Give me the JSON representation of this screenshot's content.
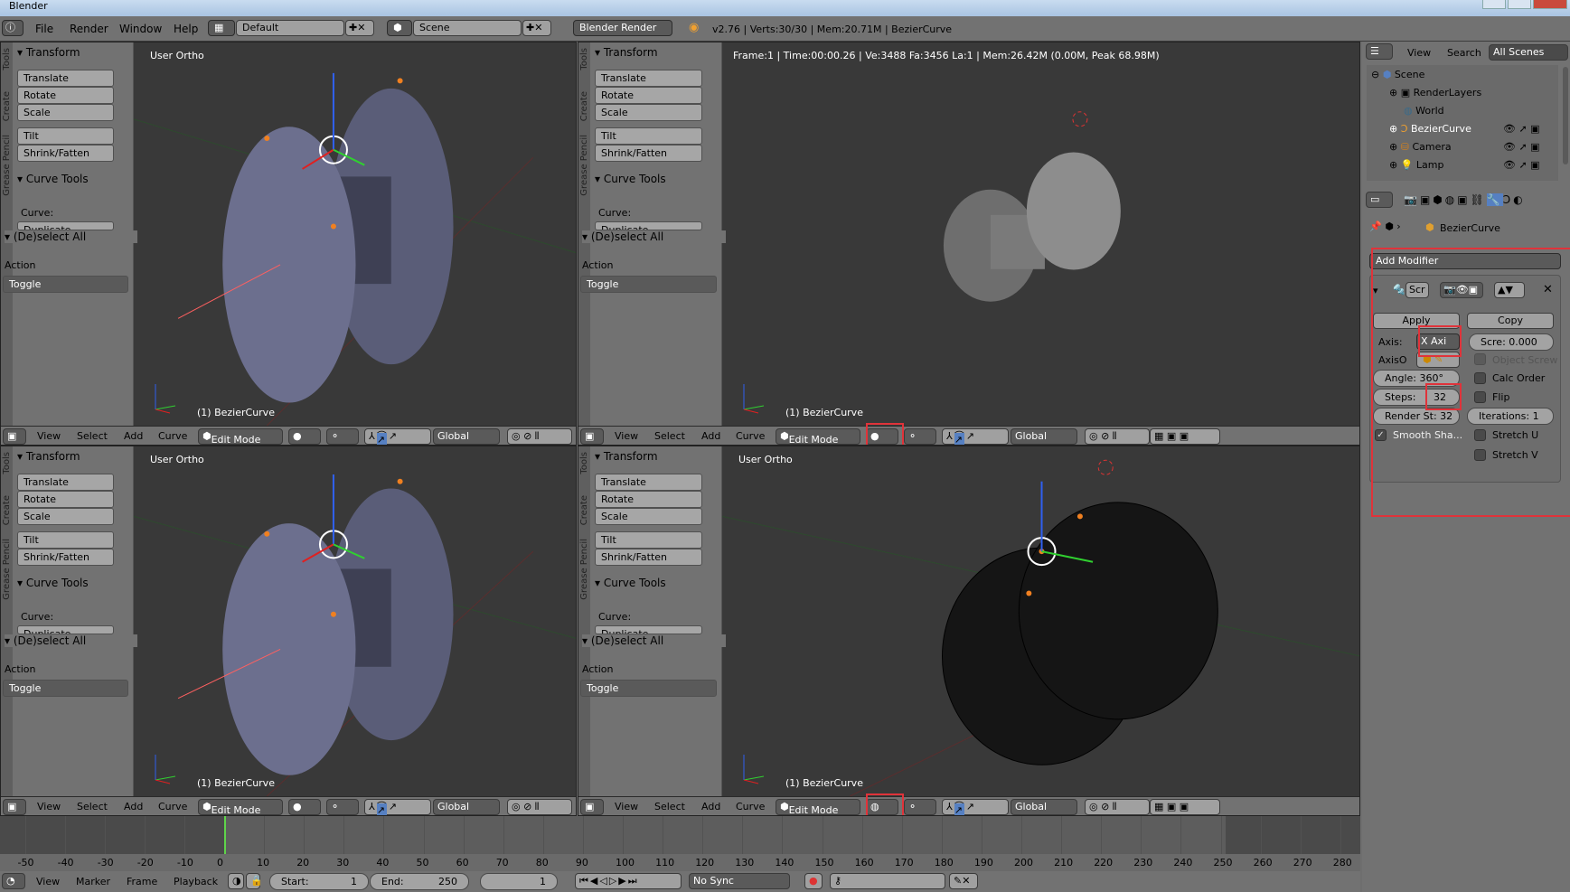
{
  "window": {
    "title": "Blender"
  },
  "topbar": {
    "menus": [
      "File",
      "Render",
      "Window",
      "Help"
    ],
    "layout": "Default",
    "scene": "Scene",
    "engine": "Blender Render",
    "stats": "v2.76 | Verts:30/30 | Mem:20.71M | BezierCurve"
  },
  "shelf": {
    "transform": "Transform",
    "buttons": [
      "Translate",
      "Rotate",
      "Scale",
      "Tilt",
      "Shrink/Fatten"
    ],
    "curve_tools": "Curve Tools",
    "curve_label": "Curve:",
    "duplicate": "Duplicate",
    "deselect": "(De)select All",
    "action": "Action",
    "toggle": "Toggle",
    "tabs": [
      "Tools",
      "Create",
      "Grease Pencil"
    ]
  },
  "views": [
    {
      "label": "User Ortho",
      "object": "(1) BezierCurve",
      "shading": "solid"
    },
    {
      "label": "Frame:1 | Time:00:00.26 | Ve:3488 Fa:3456 La:1 | Mem:26.42M (0.00M, Peak 68.98M)",
      "object": "(1) BezierCurve",
      "shading": "rendered"
    },
    {
      "label": "User Ortho",
      "object": "(1) BezierCurve",
      "shading": "solid"
    },
    {
      "label": "User Ortho",
      "object": "(1) BezierCurve",
      "shading": "wireframe"
    }
  ],
  "view_header": {
    "menus": [
      "View",
      "Select",
      "Add",
      "Curve"
    ],
    "mode": "Edit Mode",
    "orientation": "Global"
  },
  "timeline": {
    "ticks": [
      -50,
      -40,
      -30,
      -20,
      -10,
      0,
      10,
      20,
      30,
      40,
      50,
      60,
      70,
      80,
      90,
      100,
      110,
      120,
      130,
      140,
      150,
      160,
      170,
      180,
      190,
      200,
      210,
      220,
      230,
      240,
      250,
      260,
      270,
      280
    ],
    "current_frame": 1,
    "menus": [
      "View",
      "Marker",
      "Frame",
      "Playback"
    ],
    "start_label": "Start:",
    "start": "1",
    "end_label": "End:",
    "end": "250",
    "frame": "1",
    "sync": "No Sync"
  },
  "outliner": {
    "menus": [
      "View",
      "Search"
    ],
    "filter": "All Scenes",
    "items": [
      "Scene",
      "RenderLayers",
      "World",
      "BezierCurve",
      "Camera",
      "Lamp"
    ]
  },
  "properties": {
    "object": "BezierCurve",
    "add_modifier": "Add Modifier",
    "modifier_name": "Scr",
    "apply": "Apply",
    "copy": "Copy",
    "axis_label": "Axis:",
    "axis": "X Axi",
    "screw": "Scre:  0.000",
    "axis_object": "AxisO",
    "object_screw": "Object Screw",
    "angle": "Angle:  360°",
    "calc_order": "Calc Order",
    "steps_label": "Steps:",
    "steps": "32",
    "flip": "Flip",
    "render_steps": "Render St: 32",
    "iterations": "Iterations:  1",
    "smooth": "Smooth Sha...",
    "stretch_u": "Stretch U",
    "stretch_v": "Stretch V",
    "smooth_checked": true
  },
  "colors": {
    "highlight": "#e0333a",
    "viewport": "#393939",
    "panel": "#727272",
    "accent": "#5680c2"
  }
}
